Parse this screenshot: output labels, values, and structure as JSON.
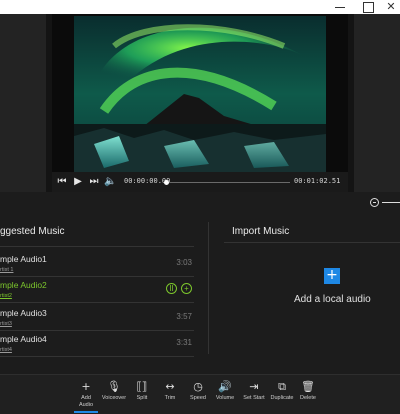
{
  "window": {
    "close_glyph": "✕"
  },
  "player": {
    "current_time": "00:00:00.00",
    "total_time": "00:01:02.51",
    "progress": 0.0
  },
  "suggested": {
    "title": "ggested Music",
    "tracks": [
      {
        "title": "mple Audio1",
        "artist": "rtist 1",
        "duration": "3:03"
      },
      {
        "title": "mple Audio2",
        "artist": "rtist2",
        "duration": ""
      },
      {
        "title": "mple Audio3",
        "artist": "rtist3",
        "duration": "3:57"
      },
      {
        "title": "mple Audio4",
        "artist": "rtist4",
        "duration": "3:31"
      }
    ],
    "selected_index": 1
  },
  "import": {
    "title": "Import Music",
    "button_glyph": "+",
    "label": "Add a local audio"
  },
  "toolbar": {
    "items": [
      {
        "glyph": "+",
        "label": "Add Audio"
      },
      {
        "glyph": "🎙",
        "label": "Voiceover"
      },
      {
        "glyph": "⟦⟧",
        "label": "Split"
      },
      {
        "glyph": "↔",
        "label": "Trim"
      },
      {
        "glyph": "◷",
        "label": "Speed"
      },
      {
        "glyph": "🔊",
        "label": "Volume"
      },
      {
        "glyph": "⇥",
        "label": "Set Start"
      },
      {
        "glyph": "⧉",
        "label": "Duplicate"
      },
      {
        "glyph": "🗑",
        "label": "Delete"
      }
    ]
  },
  "colors": {
    "accent": "#1e88e5",
    "selected": "#7cc62c"
  },
  "icons": [
    "skip-back-icon",
    "play-icon",
    "skip-forward-icon",
    "volume-icon",
    "zoom-out-icon",
    "pause-icon",
    "add-circle-icon"
  ]
}
